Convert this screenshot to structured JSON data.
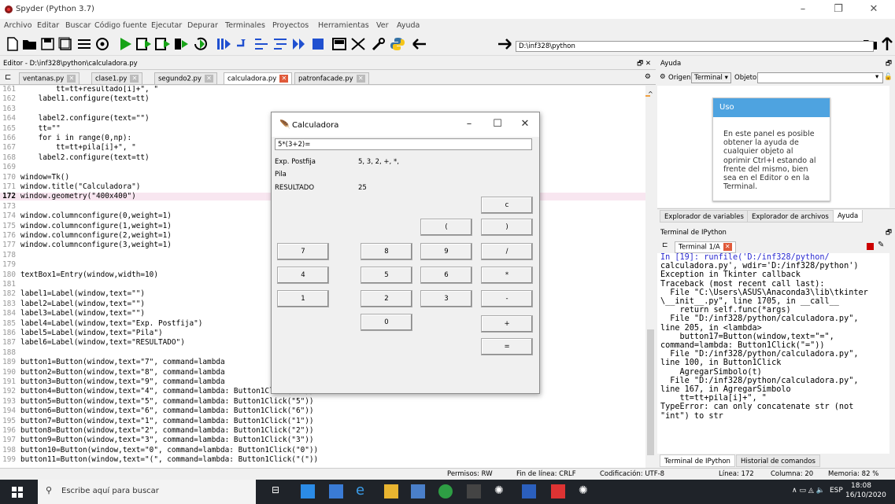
{
  "app": {
    "title": "Spyder (Python 3.7)",
    "menu": [
      "Archivo",
      "Editar",
      "Buscar",
      "Código fuente",
      "Ejecutar",
      "Depurar",
      "Terminales",
      "Proyectos",
      "Herramientas",
      "Ver",
      "Ayuda"
    ],
    "path": "D:\\inf328\\python"
  },
  "editor": {
    "header": "Editor - D:\\inf328\\python\\calculadora.py",
    "tabs": [
      {
        "label": "ventanas.py"
      },
      {
        "label": "clase1.py"
      },
      {
        "label": "segundo2.py"
      },
      {
        "label": "calculadora.py"
      },
      {
        "label": "patronfacade.py"
      }
    ],
    "lines": [
      {
        "n": "161",
        "t": "        tt=tt+resultado[i]+\", \""
      },
      {
        "n": "162",
        "t": "    label1.configure(text=tt)"
      },
      {
        "n": "163",
        "t": ""
      },
      {
        "n": "164",
        "t": "    label2.configure(text=\"\")"
      },
      {
        "n": "165",
        "t": "    tt=\"\""
      },
      {
        "n": "166",
        "t": "    for i in range(0,np):"
      },
      {
        "n": "167",
        "t": "        tt=tt+pila[i]+\", \""
      },
      {
        "n": "168",
        "t": "    label2.configure(text=tt)"
      },
      {
        "n": "169",
        "t": ""
      },
      {
        "n": "170",
        "t": "window=Tk()"
      },
      {
        "n": "171",
        "t": "window.title(\"Calculadora\")"
      },
      {
        "n": "172",
        "t": "window.geometry(\"400x400\")"
      },
      {
        "n": "173",
        "t": ""
      },
      {
        "n": "174",
        "t": "window.columnconfigure(0,weight=1)"
      },
      {
        "n": "175",
        "t": "window.columnconfigure(1,weight=1)"
      },
      {
        "n": "176",
        "t": "window.columnconfigure(2,weight=1)"
      },
      {
        "n": "177",
        "t": "window.columnconfigure(3,weight=1)"
      },
      {
        "n": "178",
        "t": ""
      },
      {
        "n": "179",
        "t": ""
      },
      {
        "n": "180",
        "t": "textBox1=Entry(window,width=10)"
      },
      {
        "n": "181",
        "t": ""
      },
      {
        "n": "182",
        "t": "label1=Label(window,text=\"\")"
      },
      {
        "n": "183",
        "t": "label2=Label(window,text=\"\")"
      },
      {
        "n": "184",
        "t": "label3=Label(window,text=\"\")"
      },
      {
        "n": "185",
        "t": "label4=Label(window,text=\"Exp. Postfija\")"
      },
      {
        "n": "186",
        "t": "label5=Label(window,text=\"Pila\")"
      },
      {
        "n": "187",
        "t": "label6=Label(window,text=\"RESULTADO\")"
      },
      {
        "n": "188",
        "t": ""
      },
      {
        "n": "189",
        "t": "button1=Button(window,text=\"7\", command=lambda"
      },
      {
        "n": "190",
        "t": "button2=Button(window,text=\"8\", command=lambda"
      },
      {
        "n": "191",
        "t": "button3=Button(window,text=\"9\", command=lambda"
      },
      {
        "n": "192",
        "t": "button4=Button(window,text=\"4\", command=lambda: Button1Click(\"4\"))"
      },
      {
        "n": "193",
        "t": "button5=Button(window,text=\"5\", command=lambda: Button1Click(\"5\"))"
      },
      {
        "n": "194",
        "t": "button6=Button(window,text=\"6\", command=lambda: Button1Click(\"6\"))"
      },
      {
        "n": "195",
        "t": "button7=Button(window,text=\"1\", command=lambda: Button1Click(\"1\"))"
      },
      {
        "n": "196",
        "t": "button8=Button(window,text=\"2\", command=lambda: Button1Click(\"2\"))"
      },
      {
        "n": "197",
        "t": "button9=Button(window,text=\"3\", command=lambda: Button1Click(\"3\"))"
      },
      {
        "n": "198",
        "t": "button10=Button(window,text=\"0\", command=lambda: Button1Click(\"0\"))"
      },
      {
        "n": "199",
        "t": "button11=Button(window,text=\"(\", command=lambda: Button1Click(\"(\"))"
      }
    ],
    "current_line": "172"
  },
  "help": {
    "header": "Ayuda",
    "source_label": "Origen",
    "source_value": "Terminal",
    "object_label": "Objeto",
    "uso_title": "Uso",
    "uso_text": "En este panel es posible obtener la ayuda de cualquier objeto al oprimir Ctrl+I estando al frente del mismo, bien sea en el Editor o en la Terminal.",
    "tabs": [
      "Explorador de variables",
      "Explorador de archivos",
      "Ayuda"
    ]
  },
  "terminal": {
    "header": "Terminal de IPython",
    "tab": "Terminal 1/A",
    "lines": [
      "In [19]: runfile('D:/inf328/python/",
      "calculadora.py', wdir='D:/inf328/python')",
      "Exception in Tkinter callback",
      "Traceback (most recent call last):",
      "  File \"C:\\Users\\ASUS\\Anaconda3\\lib\\tkinter",
      "\\__init__.py\", line 1705, in __call__",
      "    return self.func(*args)",
      "  File \"D:/inf328/python/calculadora.py\",",
      "line 205, in <lambda>",
      "    button17=Button(window,text=\"=\",",
      "command=lambda: Button1Click(\"=\"))",
      "  File \"D:/inf328/python/calculadora.py\",",
      "line 100, in Button1Click",
      "    AgregarSimbolo(t)",
      "  File \"D:/inf328/python/calculadora.py\",",
      "line 167, in AgregarSimbolo",
      "    tt=tt+pila[i]+\", \"",
      "TypeError: can only concatenate str (not",
      "\"int\") to str"
    ],
    "bottom_tabs": [
      "Terminal de IPython",
      "Historial de comandos"
    ]
  },
  "status": {
    "permisos": "Permisos: RW",
    "fin_linea": "Fin de línea: CRLF",
    "codificacion": "Codificación: UTF-8",
    "linea": "Línea: 172",
    "columna": "Columna: 20",
    "memoria": "Memoria: 82 %"
  },
  "taskbar": {
    "search": "Escribe aquí para buscar",
    "lang": "ESP",
    "time": "18:08",
    "date": "16/10/2020"
  },
  "calc": {
    "title": "Calculadora",
    "entry": "5*(3+2)=",
    "exp_label": "Exp. Postfija",
    "exp_value": "5, 3, 2, +, *,",
    "pila_label": "Pila",
    "res_label": "RESULTADO",
    "res_value": "25",
    "buttons": {
      "c": "c",
      "lp": "(",
      "rp": ")",
      "b7": "7",
      "b8": "8",
      "b9": "9",
      "div": "/",
      "b4": "4",
      "b5": "5",
      "b6": "6",
      "mul": "*",
      "b1": "1",
      "b2": "2",
      "b3": "3",
      "sub": "-",
      "b0": "0",
      "add": "+",
      "eq": "="
    }
  }
}
